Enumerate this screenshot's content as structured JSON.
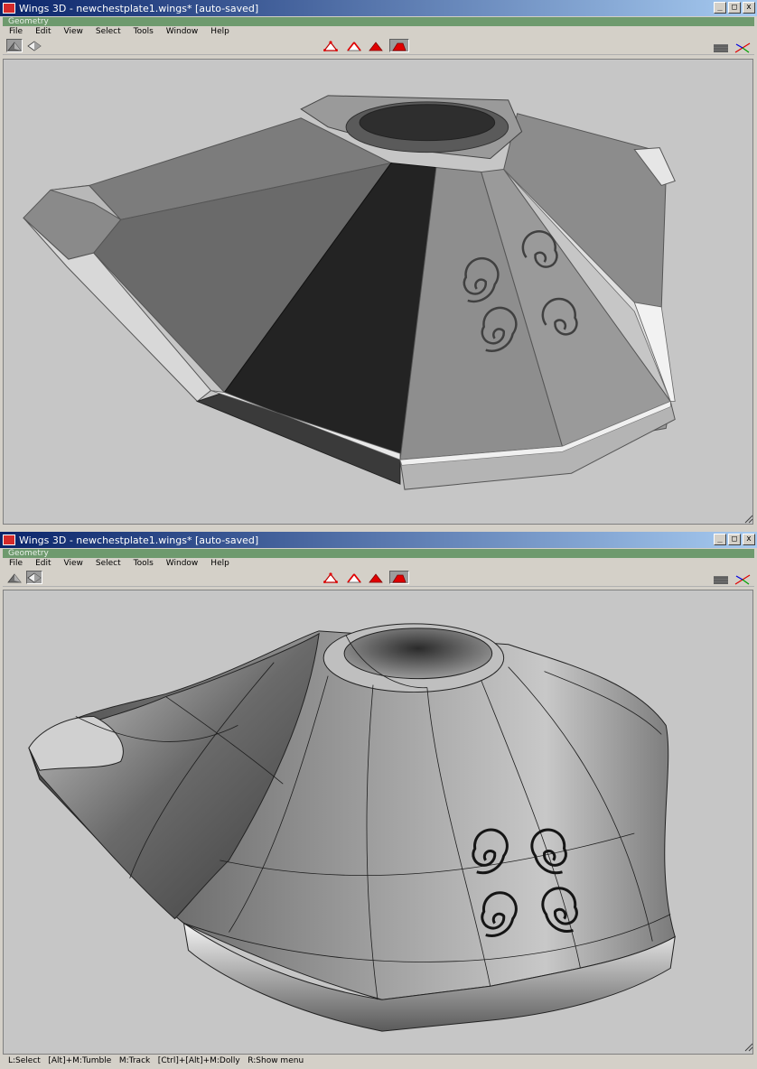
{
  "windows": [
    {
      "title": "Wings 3D - newchestplate1.wings* [auto-saved]",
      "geometry_label": "Geometry",
      "menu": [
        "File",
        "Edit",
        "View",
        "Select",
        "Tools",
        "Window",
        "Help"
      ],
      "view_mode": "flat-shaded"
    },
    {
      "title": "Wings 3D - newchestplate1.wings* [auto-saved]",
      "geometry_label": "Geometry",
      "menu": [
        "File",
        "Edit",
        "View",
        "Select",
        "Tools",
        "Window",
        "Help"
      ],
      "view_mode": "smooth-preview"
    }
  ],
  "titlebar_buttons": [
    "_",
    "□",
    "x"
  ],
  "selection_modes": [
    "vertex",
    "edge",
    "face",
    "body"
  ],
  "status": {
    "text": "L:Select   [Alt]+M:Tumble   M:Track   [Ctrl]+[Alt]+M:Dolly   R:Show menu"
  },
  "colors": {
    "titlebar_start": "#0a246a",
    "titlebar_end": "#a6caf0",
    "geometry_bar": "#6e9a6e",
    "viewport_bg": "#c6c6c6",
    "accent_red": "#e00000"
  }
}
